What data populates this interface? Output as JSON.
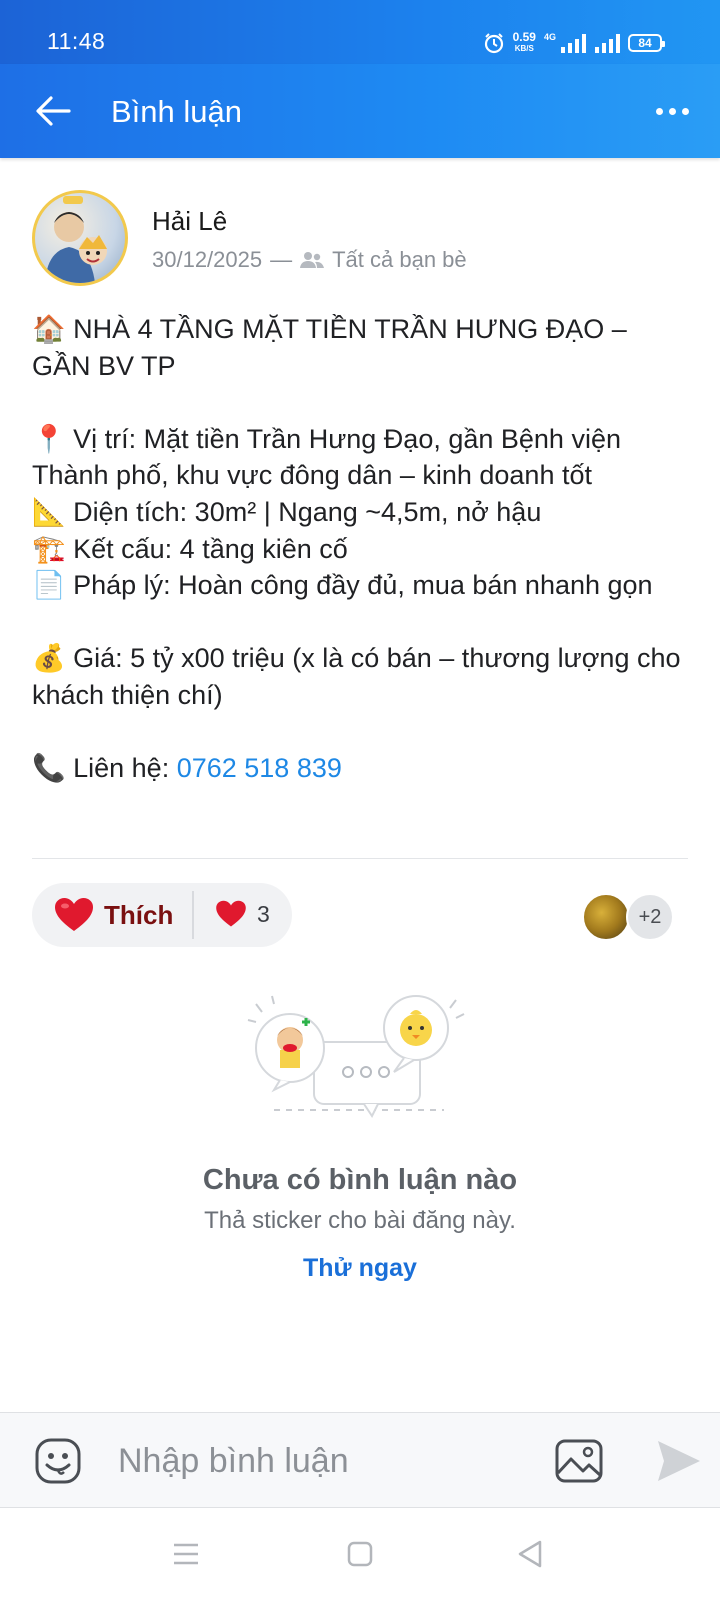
{
  "status_bar": {
    "time": "11:48",
    "net_speed": "0.59",
    "net_unit": "KB/S",
    "network_type": "4G",
    "battery": "84",
    "icons": [
      "alarm-icon",
      "signal-icon",
      "signal-icon",
      "battery-icon"
    ]
  },
  "app_bar": {
    "title": "Bình luận",
    "back_icon": "back-arrow-icon",
    "more_icon": "more-horizontal-icon"
  },
  "post": {
    "author": "Hải Lê",
    "date": "30/12/2025",
    "separator": "—",
    "privacy": "Tất cả bạn bè",
    "lines": [
      "🏠 NHÀ 4 TẦNG MẶT TIỀN TRẦN HƯNG ĐẠO – GẦN BV TP",
      "",
      "📍 Vị trí: Mặt tiền Trần Hưng Đạo, gần Bệnh viện Thành phố, khu vực đông dân – kinh doanh tốt",
      "📐 Diện tích: 30m² | Ngang ~4,5m, nở hậu",
      "🏗️ Kết cấu: 4 tầng kiên cố",
      "📄 Pháp lý: Hoàn công đầy đủ, mua bán nhanh gọn",
      "",
      "💰 Giá: 5 tỷ x00 triệu (x là có bán – thương lượng cho khách thiện chí)",
      ""
    ],
    "contact_label": "📞 Liên hệ: ",
    "contact_phone": "0762 518 839"
  },
  "reactions": {
    "like_label": "Thích",
    "count": "3",
    "more_likers": "+2",
    "heart_color": "#e0192e"
  },
  "empty_state": {
    "title": "Chưa có bình luận nào",
    "subtitle": "Thả sticker cho bài đăng này.",
    "action": "Thử ngay"
  },
  "comment_bar": {
    "placeholder": "Nhập bình luận",
    "icons": [
      "sticker-icon",
      "image-icon",
      "send-icon"
    ]
  },
  "nav_bar": {
    "icons": [
      "menu-icon",
      "home-square-icon",
      "back-triangle-icon"
    ]
  }
}
